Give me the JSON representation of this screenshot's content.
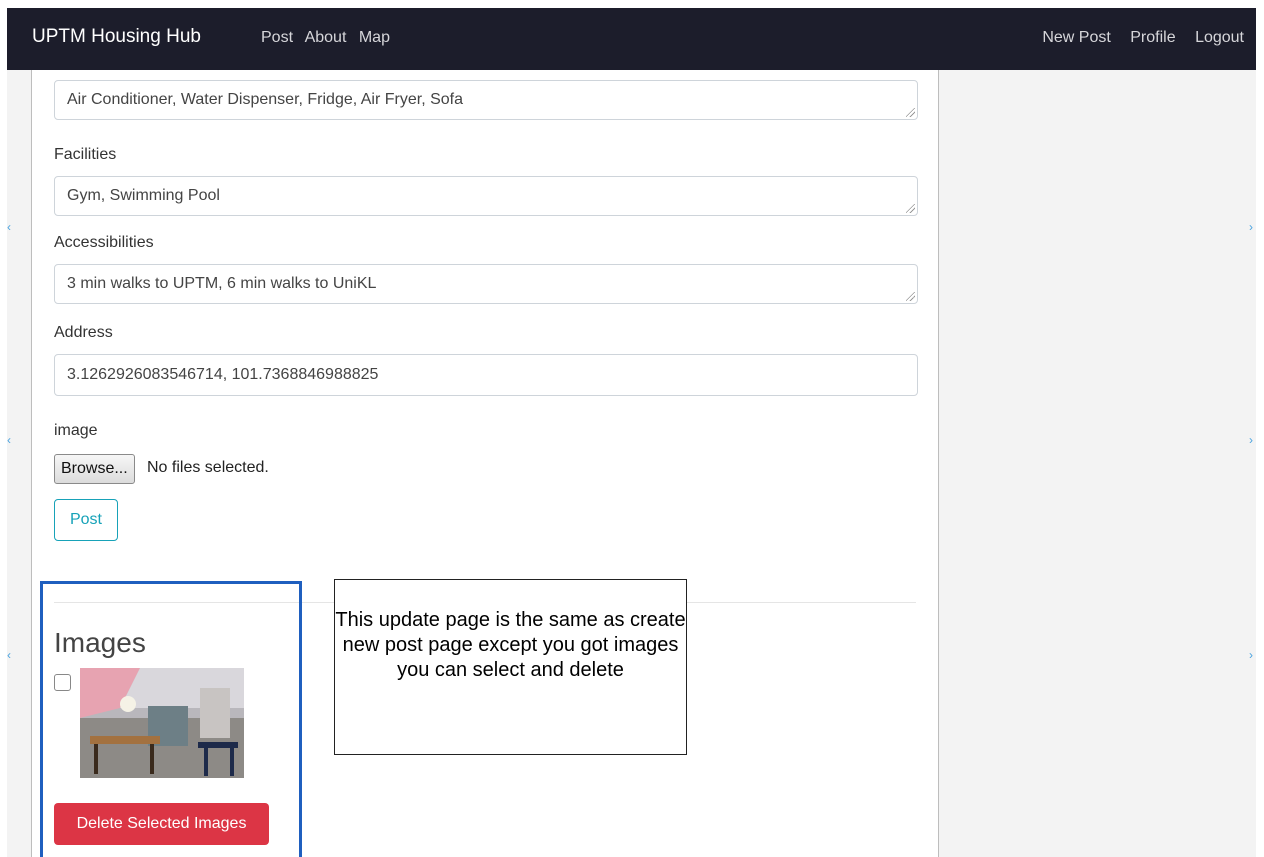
{
  "navbar": {
    "brand": "UPTM Housing Hub",
    "left_links": [
      "Post",
      "About",
      "Map"
    ],
    "right_links": [
      "New Post",
      "Profile",
      "Logout"
    ]
  },
  "form": {
    "amenities_value": "Air Conditioner, Water Dispenser, Fridge, Air Fryer, Sofa",
    "facilities_label": "Facilities",
    "facilities_value": "Gym, Swimming Pool",
    "accessibilities_label": "Accessibilities",
    "accessibilities_value": "3 min walks to UPTM, 6 min walks to UniKL",
    "address_label": "Address",
    "address_value": "3.1262926083546714, 101.7368846988825",
    "image_label": "image",
    "browse_label": "Browse...",
    "no_files_text": "No files selected.",
    "post_label": "Post"
  },
  "images_section": {
    "heading": "Images",
    "delete_label": "Delete Selected Images"
  },
  "annotation": {
    "text": "This update page is the same as create new post page except you got images you can select and delete"
  },
  "colors": {
    "navbar_bg": "#1c1d2b",
    "accent_info": "#17a2b8",
    "danger": "#dc3545",
    "highlight_border": "#1f5fbf"
  }
}
